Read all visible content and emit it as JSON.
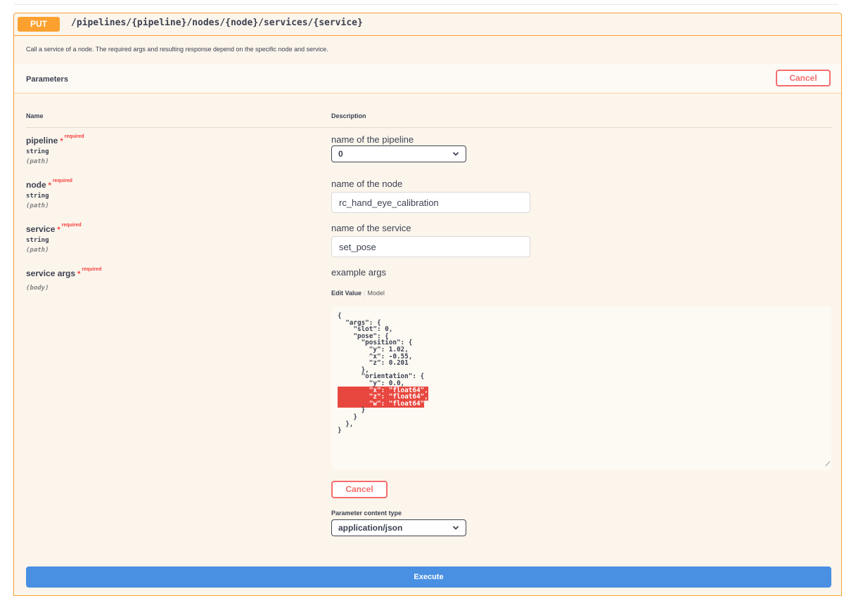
{
  "endpoint": {
    "method": "PUT",
    "path": "/pipelines/{pipeline}/nodes/{node}/services/{service}",
    "description": "Call a service of a node. The required args and resulting response depend on the specific node and service."
  },
  "parameters_section": {
    "title": "Parameters",
    "cancel_label": "Cancel",
    "col_name": "Name",
    "col_description": "Description"
  },
  "required_label": "required",
  "required_star": "*",
  "params": [
    {
      "name": "pipeline",
      "type": "string",
      "in": "(path)",
      "description": "name of the pipeline",
      "value": "0"
    },
    {
      "name": "node",
      "type": "string",
      "in": "(path)",
      "description": "name of the node",
      "value": "rc_hand_eye_calibration"
    },
    {
      "name": "service",
      "type": "string",
      "in": "(path)",
      "description": "name of the service",
      "value": "set_pose"
    },
    {
      "name": "service args",
      "type": "",
      "in": "(body)",
      "description": "example args"
    }
  ],
  "body_editor": {
    "tab_edit": "Edit Value",
    "tab_model": "Model",
    "lines_before": "{\n  \"args\": {\n    \"slot\": 0,\n    \"pose\": {\n      \"position\": {\n        \"y\": 1.02,\n        \"x\": -0.55,\n        \"z\": 0.201\n      },\n      \"orientation\": {\n        \"y\": 0.0,",
    "hl_1": "        \"x\": \"float64\",",
    "hl_2": "        \"z\": \"float64\",",
    "hl_3": "        \"w\": \"float64\"",
    "lines_after": "      }\n    }\n  },\n}",
    "cancel_label": "Cancel"
  },
  "content_type": {
    "label": "Parameter content type",
    "value": "application/json"
  },
  "execute_label": "Execute",
  "colors": {
    "put": "#fca130",
    "execute": "#4990e2",
    "cancel": "#f56c6c",
    "highlight": "#e8473f"
  }
}
